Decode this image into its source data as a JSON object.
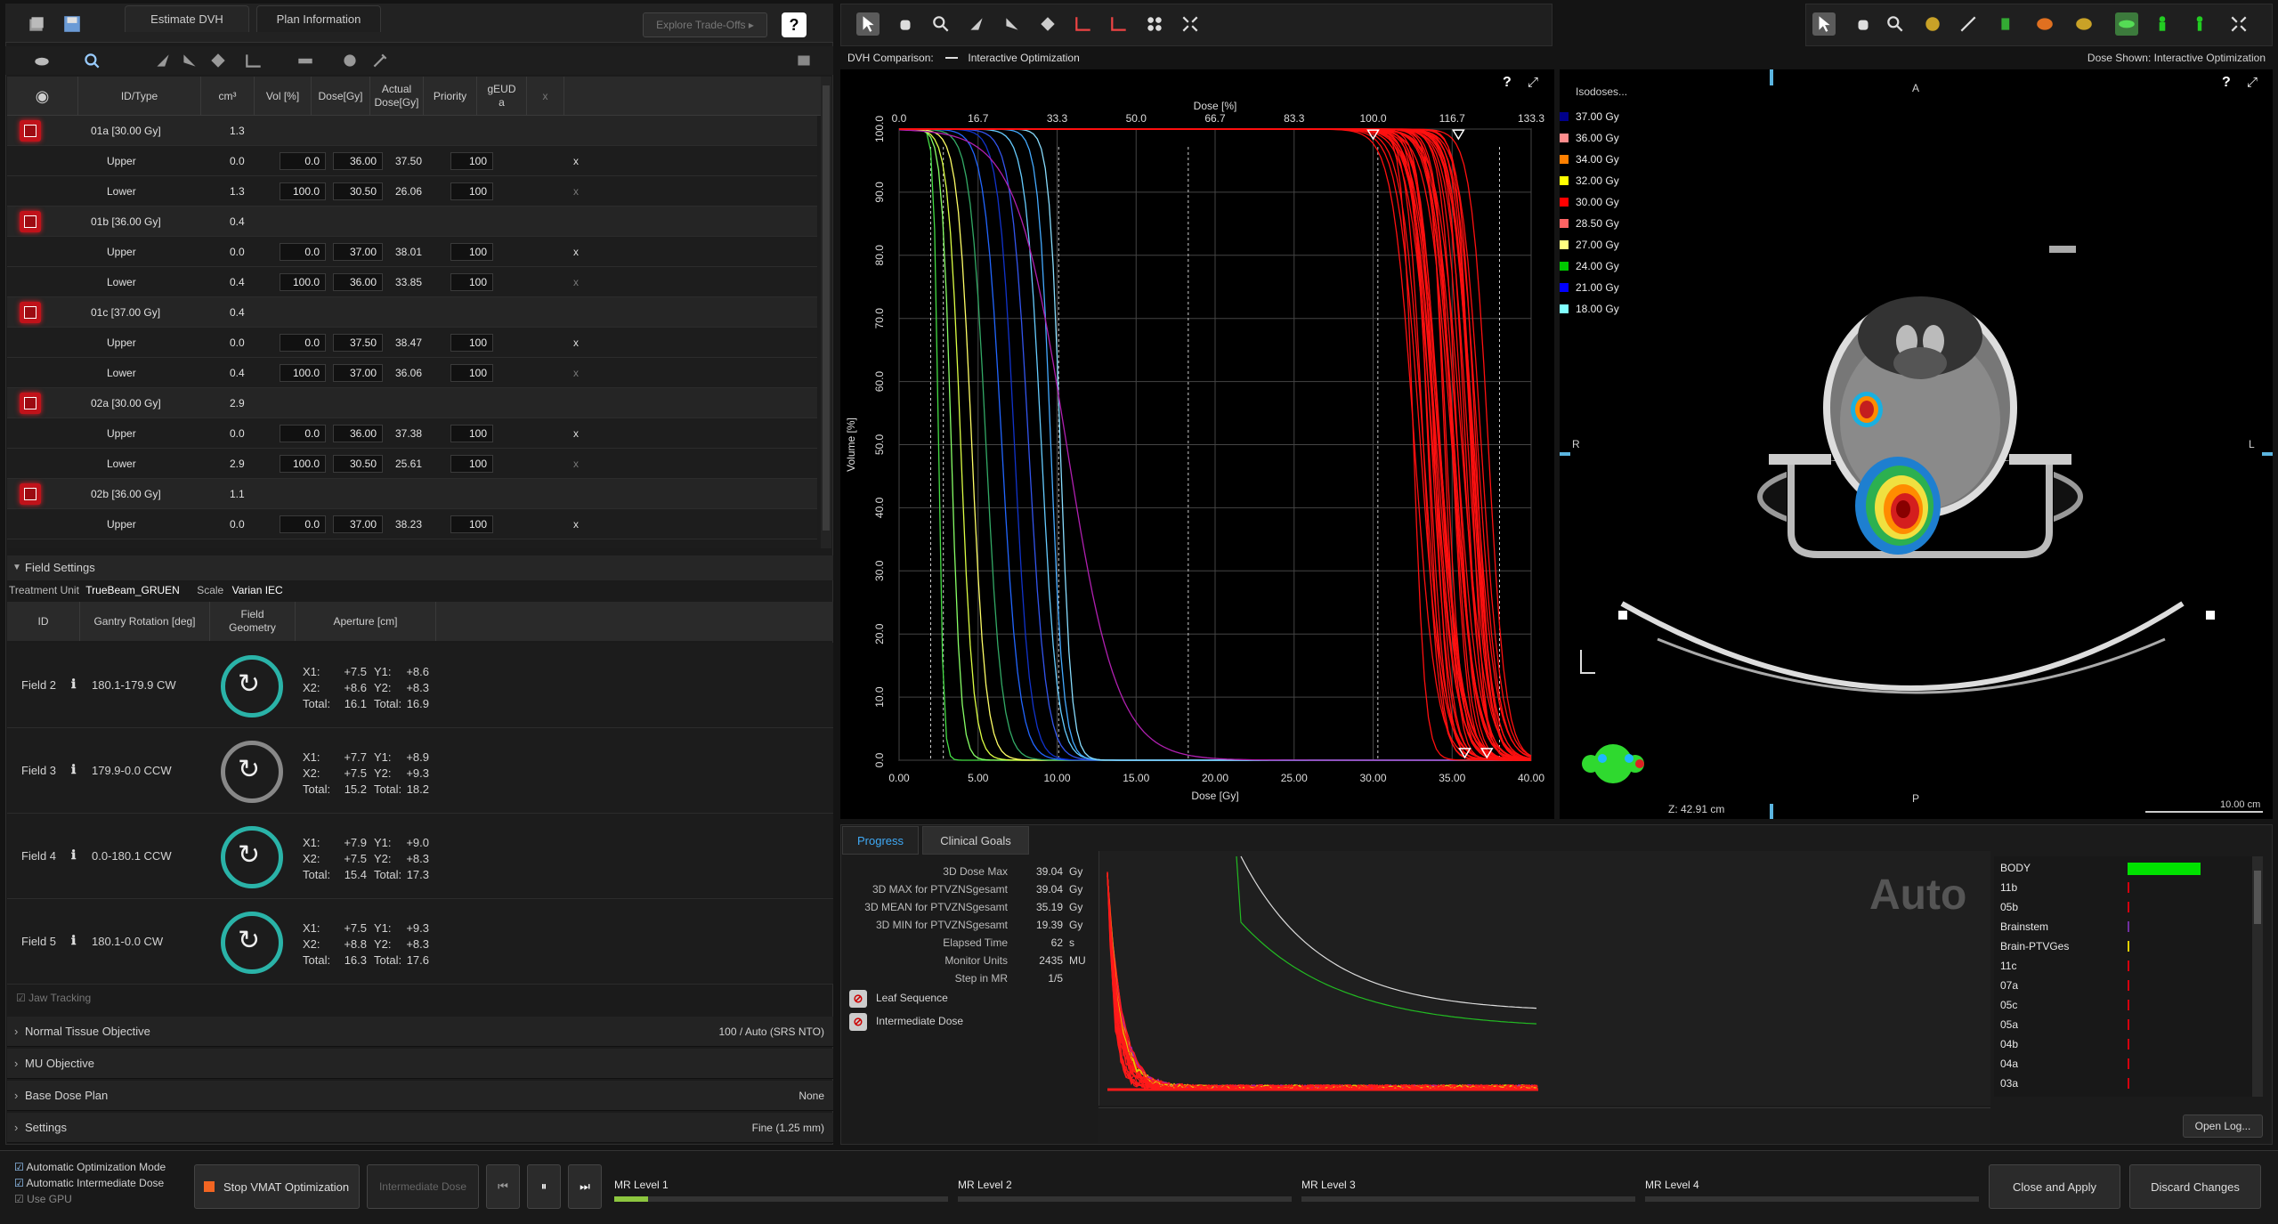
{
  "toolbar": {
    "tabs": [
      "Estimate DVH",
      "Plan Information"
    ],
    "explore": "Explore Trade-Offs"
  },
  "table": {
    "headers": [
      "ID/Type",
      "cm³",
      "Vol [%]",
      "Dose[Gy]",
      "Actual Dose[Gy]",
      "Priority",
      "gEUD a",
      "x"
    ],
    "rows": [
      {
        "kind": "obj",
        "id": "01a [30.00 Gy]",
        "cm3": "1.3"
      },
      {
        "kind": "sub",
        "id": "Upper",
        "cm3": "0.0",
        "vol": "0.0",
        "dose": "36.00",
        "actual": "37.50",
        "prio": "100",
        "x": "x"
      },
      {
        "kind": "sub",
        "id": "Lower",
        "cm3": "1.3",
        "vol": "100.0",
        "dose": "30.50",
        "actual": "26.06",
        "prio": "100",
        "x": "x"
      },
      {
        "kind": "obj",
        "id": "01b [36.00 Gy]",
        "cm3": "0.4"
      },
      {
        "kind": "sub",
        "id": "Upper",
        "cm3": "0.0",
        "vol": "0.0",
        "dose": "37.00",
        "actual": "38.01",
        "prio": "100",
        "x": "x"
      },
      {
        "kind": "sub",
        "id": "Lower",
        "cm3": "0.4",
        "vol": "100.0",
        "dose": "36.00",
        "actual": "33.85",
        "prio": "100",
        "x": "x"
      },
      {
        "kind": "obj",
        "id": "01c [37.00 Gy]",
        "cm3": "0.4"
      },
      {
        "kind": "sub",
        "id": "Upper",
        "cm3": "0.0",
        "vol": "0.0",
        "dose": "37.50",
        "actual": "38.47",
        "prio": "100",
        "x": "x"
      },
      {
        "kind": "sub",
        "id": "Lower",
        "cm3": "0.4",
        "vol": "100.0",
        "dose": "37.00",
        "actual": "36.06",
        "prio": "100",
        "x": "x"
      },
      {
        "kind": "obj",
        "id": "02a [30.00 Gy]",
        "cm3": "2.9"
      },
      {
        "kind": "sub",
        "id": "Upper",
        "cm3": "0.0",
        "vol": "0.0",
        "dose": "36.00",
        "actual": "37.38",
        "prio": "100",
        "x": "x"
      },
      {
        "kind": "sub",
        "id": "Lower",
        "cm3": "2.9",
        "vol": "100.0",
        "dose": "30.50",
        "actual": "25.61",
        "prio": "100",
        "x": "x"
      },
      {
        "kind": "obj",
        "id": "02b [36.00 Gy]",
        "cm3": "1.1"
      },
      {
        "kind": "sub",
        "id": "Upper",
        "cm3": "0.0",
        "vol": "0.0",
        "dose": "37.00",
        "actual": "38.23",
        "prio": "100",
        "x": "x"
      }
    ]
  },
  "field_settings": {
    "title": "Field Settings",
    "treatment_unit_label": "Treatment Unit",
    "treatment_unit": "TrueBeam_GRUEN",
    "scale_label": "Scale",
    "scale": "Varian IEC",
    "headers": [
      "ID",
      "Gantry Rotation [deg]",
      "Field Geometry",
      "Aperture [cm]"
    ],
    "fields": [
      {
        "id": "Field 2",
        "rot": "180.1-179.9 CW",
        "x1": "+7.5",
        "y1": "+8.6",
        "x2": "+8.6",
        "y2": "+8.3",
        "tx": "16.1",
        "ty": "16.9"
      },
      {
        "id": "Field 3",
        "rot": "179.9-0.0 CCW",
        "x1": "+7.7",
        "y1": "+8.9",
        "x2": "+7.5",
        "y2": "+9.3",
        "tx": "15.2",
        "ty": "18.2"
      },
      {
        "id": "Field 4",
        "rot": "0.0-180.1 CCW",
        "x1": "+7.9",
        "y1": "+9.0",
        "x2": "+7.5",
        "y2": "+8.3",
        "tx": "15.4",
        "ty": "17.3"
      },
      {
        "id": "Field 5",
        "rot": "180.1-0.0 CW",
        "x1": "+7.5",
        "y1": "+9.3",
        "x2": "+8.8",
        "y2": "+8.3",
        "tx": "16.3",
        "ty": "17.6"
      }
    ],
    "jaw_tracking": "Jaw Tracking"
  },
  "sections": [
    {
      "label": "Normal Tissue Objective",
      "value": "100 / Auto (SRS NTO)"
    },
    {
      "label": "MU Objective",
      "value": ""
    },
    {
      "label": "Base Dose Plan",
      "value": "None"
    },
    {
      "label": "Settings",
      "value": "Fine (1.25 mm)"
    }
  ],
  "dvh": {
    "caption_label": "DVH Comparison:",
    "caption_value": "Interactive Optimization",
    "top_axis_title": "Dose [%]",
    "top_ticks": [
      "0.0",
      "16.7",
      "33.3",
      "50.0",
      "66.7",
      "83.3",
      "100.0",
      "116.7",
      "133.3"
    ],
    "x_title": "Dose [Gy]",
    "x_ticks": [
      "0.00",
      "5.00",
      "10.00",
      "15.00",
      "20.00",
      "25.00",
      "30.00",
      "35.00",
      "40.00"
    ],
    "y_title": "Volume [%]",
    "y_ticks": [
      "0.0",
      "10.0",
      "20.0",
      "30.0",
      "40.0",
      "50.0",
      "60.0",
      "70.0",
      "80.0",
      "90.0",
      "100.0"
    ]
  },
  "image_view": {
    "dose_shown": "Dose Shown: Interactive Optimization",
    "isodoses_title": "Isodoses...",
    "isodoses": [
      {
        "label": "37.00 Gy",
        "color": "#00008b"
      },
      {
        "label": "36.00 Gy",
        "color": "#ff8c8c"
      },
      {
        "label": "34.00 Gy",
        "color": "#ff8000"
      },
      {
        "label": "32.00 Gy",
        "color": "#ffff00"
      },
      {
        "label": "30.00 Gy",
        "color": "#ff0000"
      },
      {
        "label": "28.50 Gy",
        "color": "#ff6464"
      },
      {
        "label": "27.00 Gy",
        "color": "#ffff80"
      },
      {
        "label": "24.00 Gy",
        "color": "#00c800"
      },
      {
        "label": "21.00 Gy",
        "color": "#0000ff"
      },
      {
        "label": "18.00 Gy",
        "color": "#80ffff"
      }
    ],
    "orient": {
      "a": "A",
      "p": "P",
      "r": "R",
      "l": "L"
    },
    "z": "Z: 42.91 cm",
    "scale": "10.00 cm"
  },
  "progress": {
    "tabs": [
      "Progress",
      "Clinical Goals"
    ],
    "rows": [
      {
        "label": "3D Dose Max",
        "value": "39.04",
        "unit": "Gy"
      },
      {
        "label": "3D MAX for PTVZNSgesamt",
        "value": "39.04",
        "unit": "Gy"
      },
      {
        "label": "3D MEAN for PTVZNSgesamt",
        "value": "35.19",
        "unit": "Gy"
      },
      {
        "label": "3D MIN for PTVZNSgesamt",
        "value": "19.39",
        "unit": "Gy"
      },
      {
        "label": "Elapsed Time",
        "value": "62",
        "unit": "s"
      },
      {
        "label": "Monitor Units",
        "value": "2435",
        "unit": "MU"
      },
      {
        "label": "Step in MR",
        "value": "1/5",
        "unit": ""
      }
    ],
    "leaf": "Leaf Sequence",
    "intermediate": "Intermediate Dose",
    "auto": "Auto",
    "open_log": "Open Log..."
  },
  "structures": [
    "BODY",
    "11b",
    "05b",
    "Brainstem",
    "Brain-PTVGes",
    "11c",
    "07a",
    "05c",
    "05a",
    "04b",
    "04a",
    "03a"
  ],
  "bottom": {
    "auto_opt": "Automatic Optimization Mode",
    "auto_int": "Automatic Intermediate Dose",
    "use_gpu": "Use GPU",
    "stop": "Stop VMAT Optimization",
    "intermediate": "Intermediate Dose",
    "mr_levels": [
      "MR Level 1",
      "MR Level 2",
      "MR Level 3",
      "MR Level 4"
    ],
    "mr1_progress": 0.1,
    "close_apply": "Close and Apply",
    "discard": "Discard Changes"
  }
}
